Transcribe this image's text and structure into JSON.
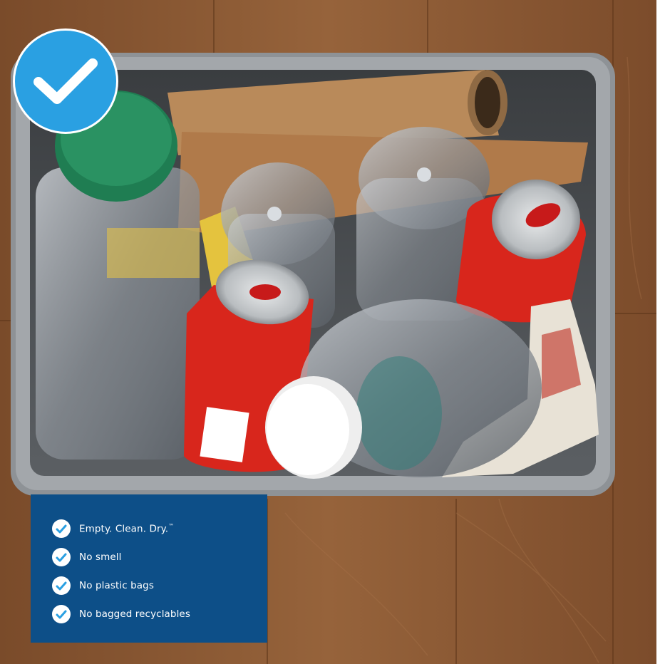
{
  "image": {
    "subject": "recycling bin with bottles, cans and cardboard",
    "colors": {
      "wood_floor": "#8a5a34",
      "bin_gray": "#8e9296",
      "badge_blue": "#2aa0e2",
      "panel_blue": "#0d4f88",
      "can_red": "#d8261c",
      "cap_green": "#1f7d52"
    },
    "badge_icon": "checkmark-icon"
  },
  "checklist": {
    "icon": "check-circle-icon",
    "items": [
      {
        "label": "Empty. Clean. Dry.",
        "mark": "™"
      },
      {
        "label": "No smell",
        "mark": ""
      },
      {
        "label": "No plastic bags",
        "mark": ""
      },
      {
        "label": "No bagged recyclables",
        "mark": ""
      }
    ]
  }
}
